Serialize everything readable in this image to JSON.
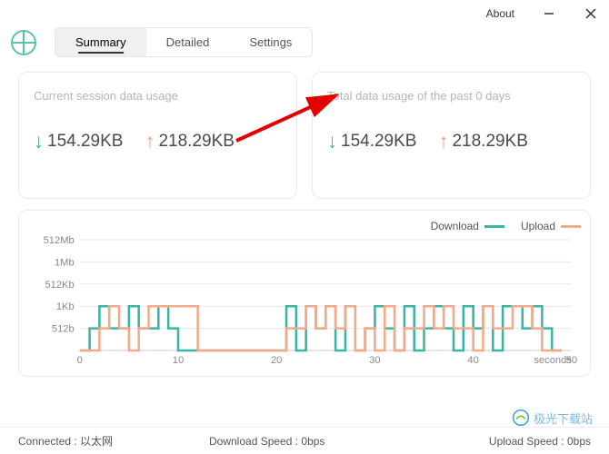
{
  "window": {
    "about_label": "About"
  },
  "tabs": {
    "summary": "Summary",
    "detailed": "Detailed",
    "settings": "Settings"
  },
  "cards": {
    "current": {
      "title": "Current session data usage",
      "download": "154.29KB",
      "upload": "218.29KB"
    },
    "total": {
      "title": "Total data usage of the past 0 days",
      "download": "154.29KB",
      "upload": "218.29KB"
    }
  },
  "chart": {
    "legend_download": "Download",
    "legend_upload": "Upload",
    "xlabel": "seconds",
    "colors": {
      "download": "#3bb5a3",
      "upload": "#f5a989"
    }
  },
  "status": {
    "connected": "Connected : 以太网",
    "download_speed": "Download Speed : 0bps",
    "upload_speed": "Upload Speed : 0bps"
  },
  "watermark": {
    "text": "极光下载站",
    "url": "7.com"
  },
  "chart_data": {
    "type": "line",
    "title": "",
    "xlabel": "seconds",
    "ylabel": "",
    "y_ticks": [
      "512Mb",
      "1Mb",
      "512Kb",
      "1Kb",
      "512b"
    ],
    "x_ticks": [
      0,
      10,
      20,
      30,
      40,
      50
    ],
    "xlim": [
      0,
      50
    ],
    "series": [
      {
        "name": "Download",
        "color": "#3bb5a3",
        "x": [
          0,
          1,
          2,
          3,
          4,
          5,
          6,
          7,
          8,
          9,
          10,
          11,
          12,
          13,
          14,
          15,
          16,
          17,
          18,
          19,
          20,
          21,
          22,
          23,
          24,
          25,
          26,
          27,
          28,
          29,
          30,
          31,
          32,
          33,
          34,
          35,
          36,
          37,
          38,
          39,
          40,
          41,
          42,
          43,
          44,
          45,
          46,
          47,
          48,
          49
        ],
        "y_label": [
          "0",
          "512b",
          "1Kb",
          "512b",
          "512b",
          "1Kb",
          "512b",
          "512b",
          "1Kb",
          "512b",
          "0",
          "0",
          "0",
          "0",
          "0",
          "0",
          "0",
          "0",
          "0",
          "0",
          "0",
          "1Kb",
          "0",
          "1Kb",
          "512b",
          "1Kb",
          "0",
          "1Kb",
          "0",
          "512b",
          "1Kb",
          "512b",
          "0",
          "1Kb",
          "0",
          "512b",
          "1Kb",
          "512b",
          "0",
          "1Kb",
          "512b",
          "1Kb",
          "0",
          "1Kb",
          "1Kb",
          "512b",
          "1Kb",
          "512b",
          "0",
          "0"
        ]
      },
      {
        "name": "Upload",
        "color": "#f5a989",
        "x": [
          0,
          1,
          2,
          3,
          4,
          5,
          6,
          7,
          8,
          9,
          10,
          11,
          12,
          13,
          14,
          15,
          16,
          17,
          18,
          19,
          20,
          21,
          22,
          23,
          24,
          25,
          26,
          27,
          28,
          29,
          30,
          31,
          32,
          33,
          34,
          35,
          36,
          37,
          38,
          39,
          40,
          41,
          42,
          43,
          44,
          45,
          46,
          47,
          48,
          49
        ],
        "y_label": [
          "0",
          "0",
          "512b",
          "1Kb",
          "512b",
          "0",
          "512b",
          "1Kb",
          "1Kb",
          "1Kb",
          "1Kb",
          "1Kb",
          "0",
          "0",
          "0",
          "0",
          "0",
          "0",
          "0",
          "0",
          "0",
          "512b",
          "512b",
          "1Kb",
          "512b",
          "1Kb",
          "512b",
          "1Kb",
          "0",
          "512b",
          "0",
          "1Kb",
          "0",
          "512b",
          "512b",
          "1Kb",
          "512b",
          "1Kb",
          "512b",
          "512b",
          "0",
          "1Kb",
          "512b",
          "512b",
          "1Kb",
          "1Kb",
          "512b",
          "0",
          "0",
          "0"
        ]
      }
    ]
  }
}
